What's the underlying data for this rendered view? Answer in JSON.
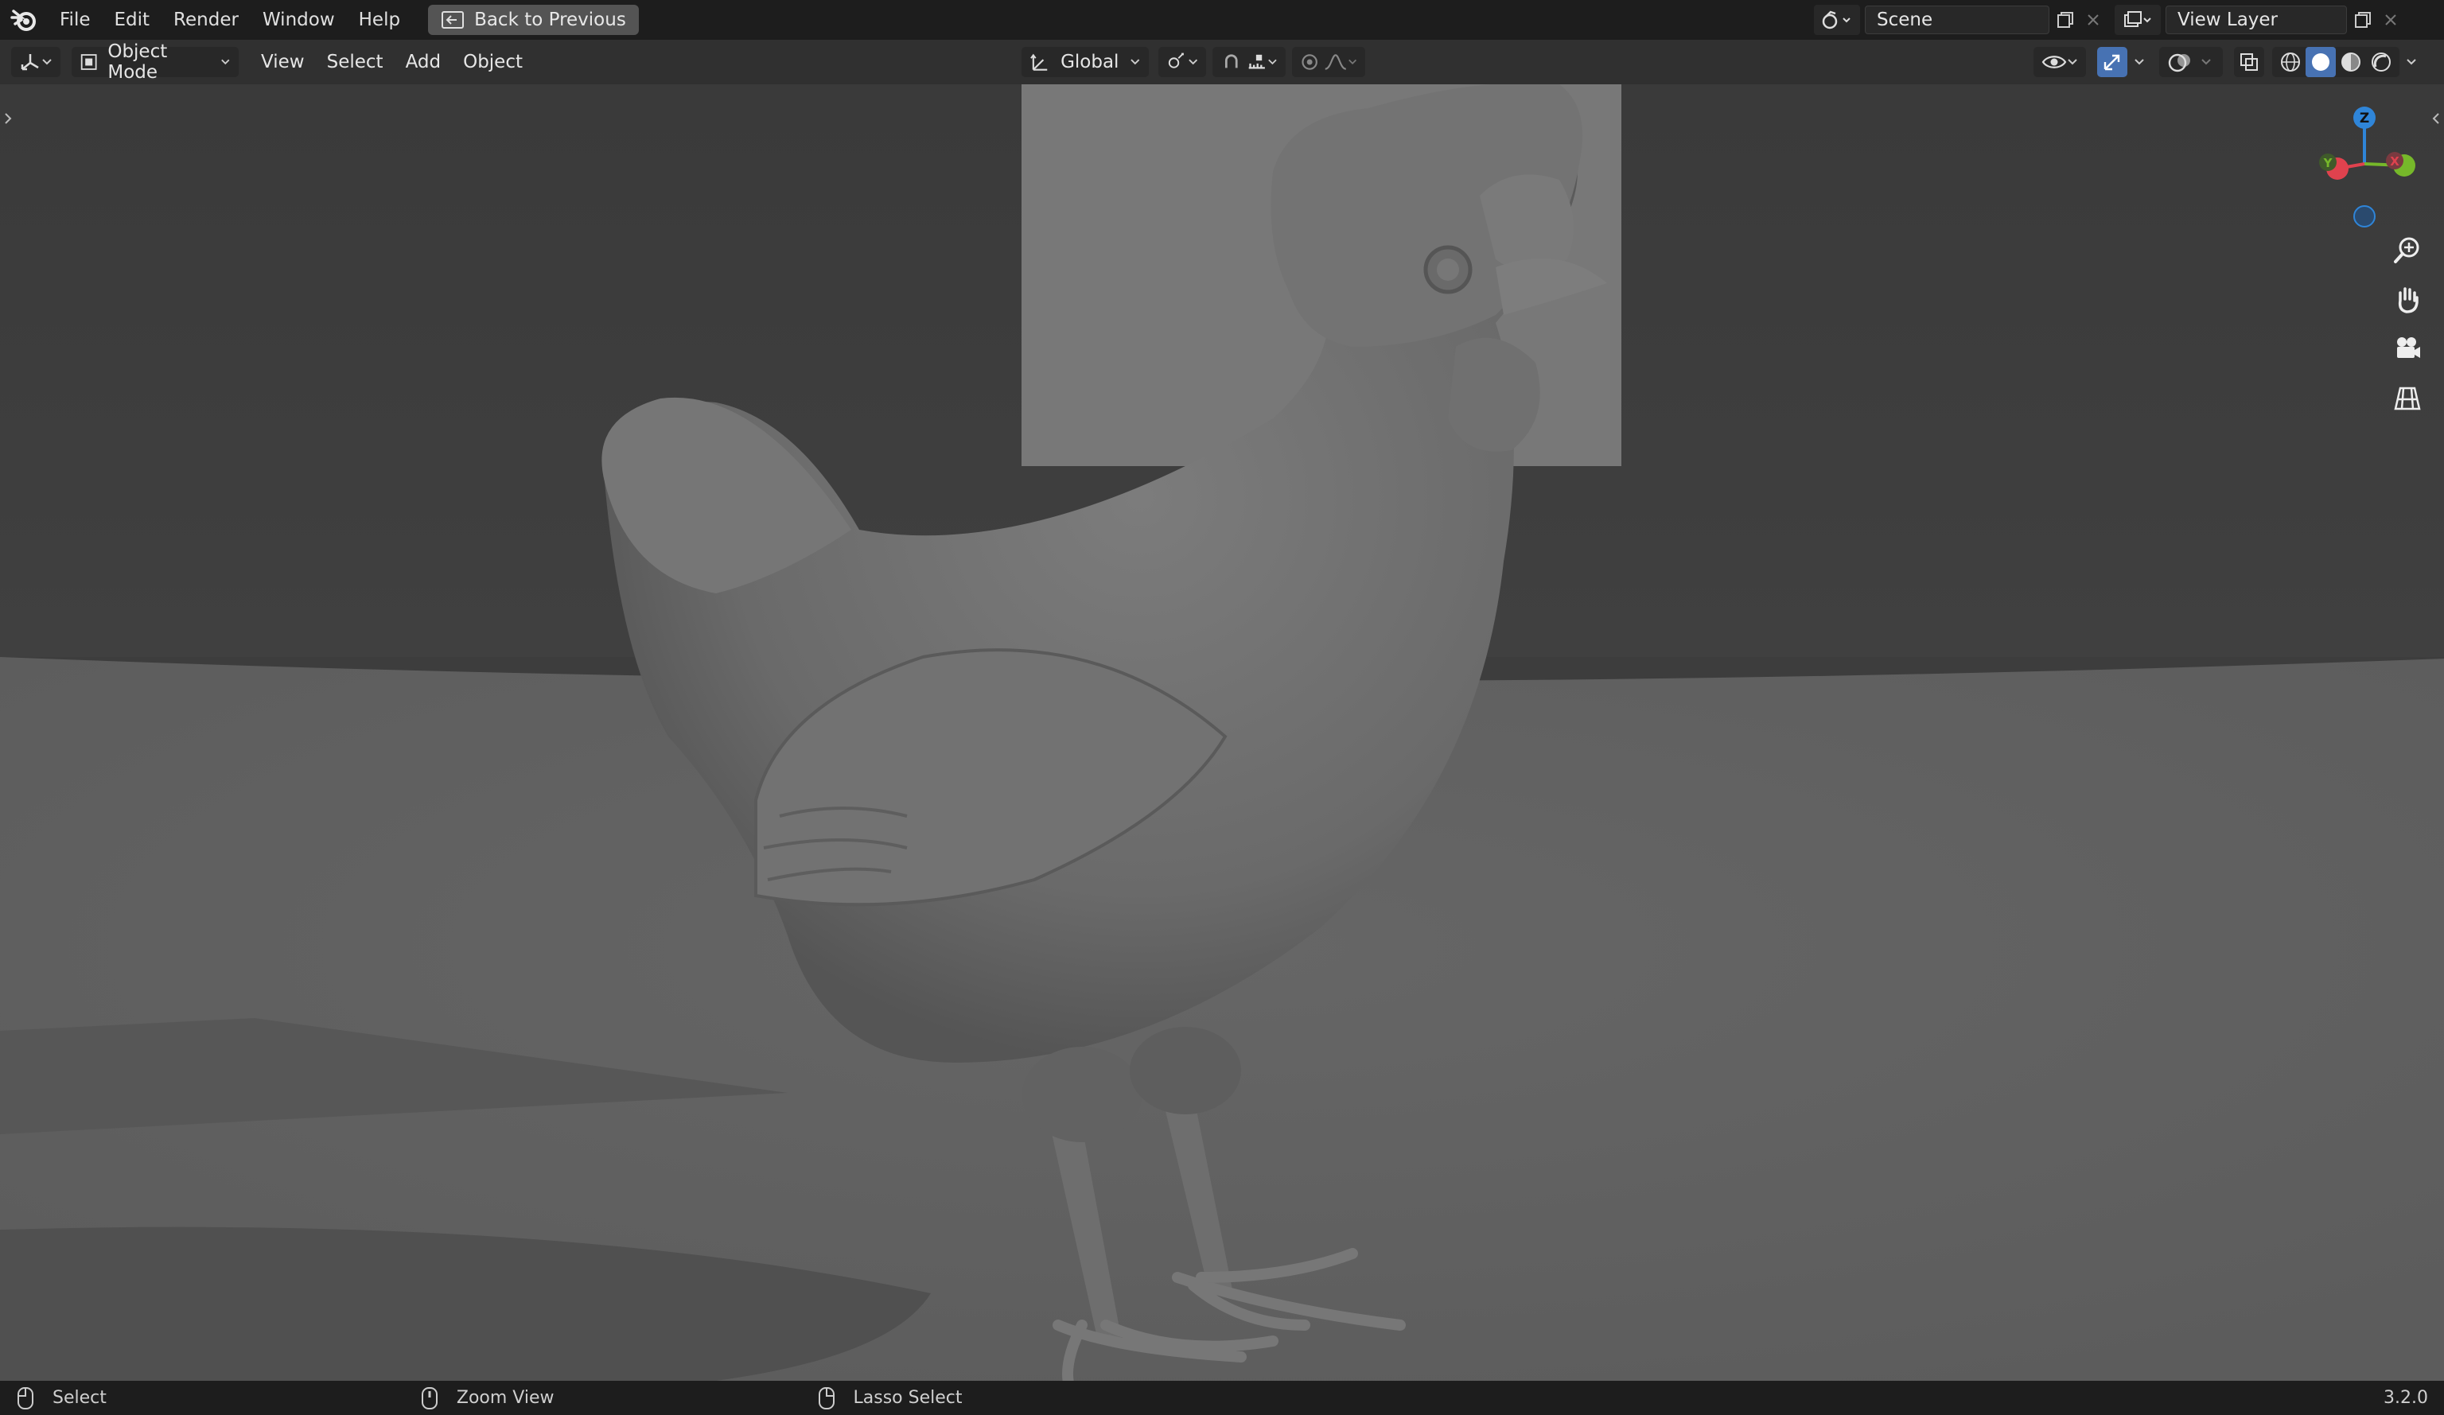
{
  "topbar": {
    "menus": [
      "File",
      "Edit",
      "Render",
      "Window",
      "Help"
    ],
    "back_button": "Back to Previous",
    "scene": "Scene",
    "view_layer": "View Layer"
  },
  "header": {
    "mode": "Object Mode",
    "menus": [
      "View",
      "Select",
      "Add",
      "Object"
    ],
    "orientation": "Global"
  },
  "gizmo": {
    "z": "Z",
    "y": "Y",
    "x": "X"
  },
  "statusbar": {
    "hint1": "Select",
    "hint2": "Zoom View",
    "hint3": "Lasso Select",
    "version": "3.2.0"
  },
  "colors": {
    "accent_blue": "#4772b3",
    "axis_x": "#e0424e",
    "axis_y": "#76b82a",
    "axis_z": "#2f85d8"
  }
}
